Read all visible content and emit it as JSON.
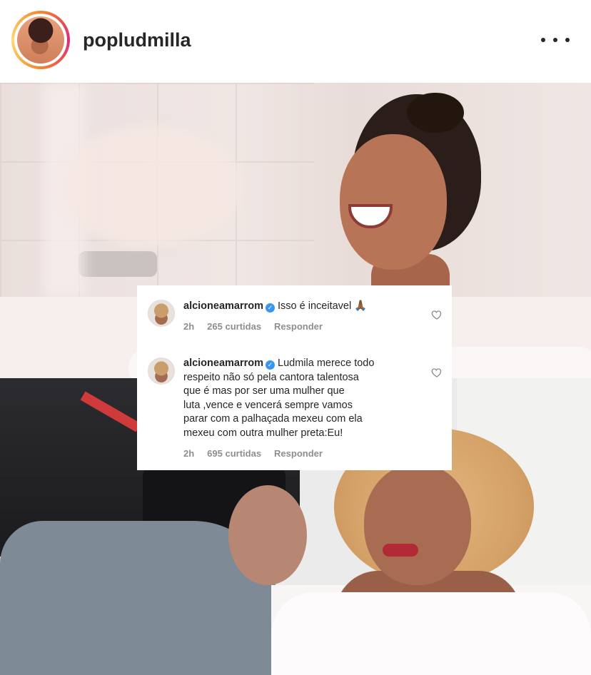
{
  "header": {
    "username": "popludmilla",
    "more_icon": "more-options-icon"
  },
  "comments": [
    {
      "user": "alcioneamarrom",
      "verified": true,
      "text": "Isso é inceitavel 🙏🏾",
      "time": "2h",
      "likes": "265 curtidas",
      "reply": "Responder"
    },
    {
      "user": "alcioneamarrom",
      "verified": true,
      "text_lines": [
        "Ludmila merece todo",
        "respeito não só pela cantora talentosa",
        "que é mas por ser uma mulher que",
        "luta ,vence e vencerá sempre vamos",
        "parar com a palhaçada mexeu com ela",
        "mexeu com outra mulher preta:Eu!"
      ],
      "time": "2h",
      "likes": "695 curtidas",
      "reply": "Responder"
    }
  ],
  "icons": {
    "heart": "heart-outline-icon",
    "verified": "verified-badge-icon"
  },
  "colors": {
    "verified": "#3897f0",
    "meta_text": "#8e8e8e",
    "primary_text": "#262626"
  }
}
